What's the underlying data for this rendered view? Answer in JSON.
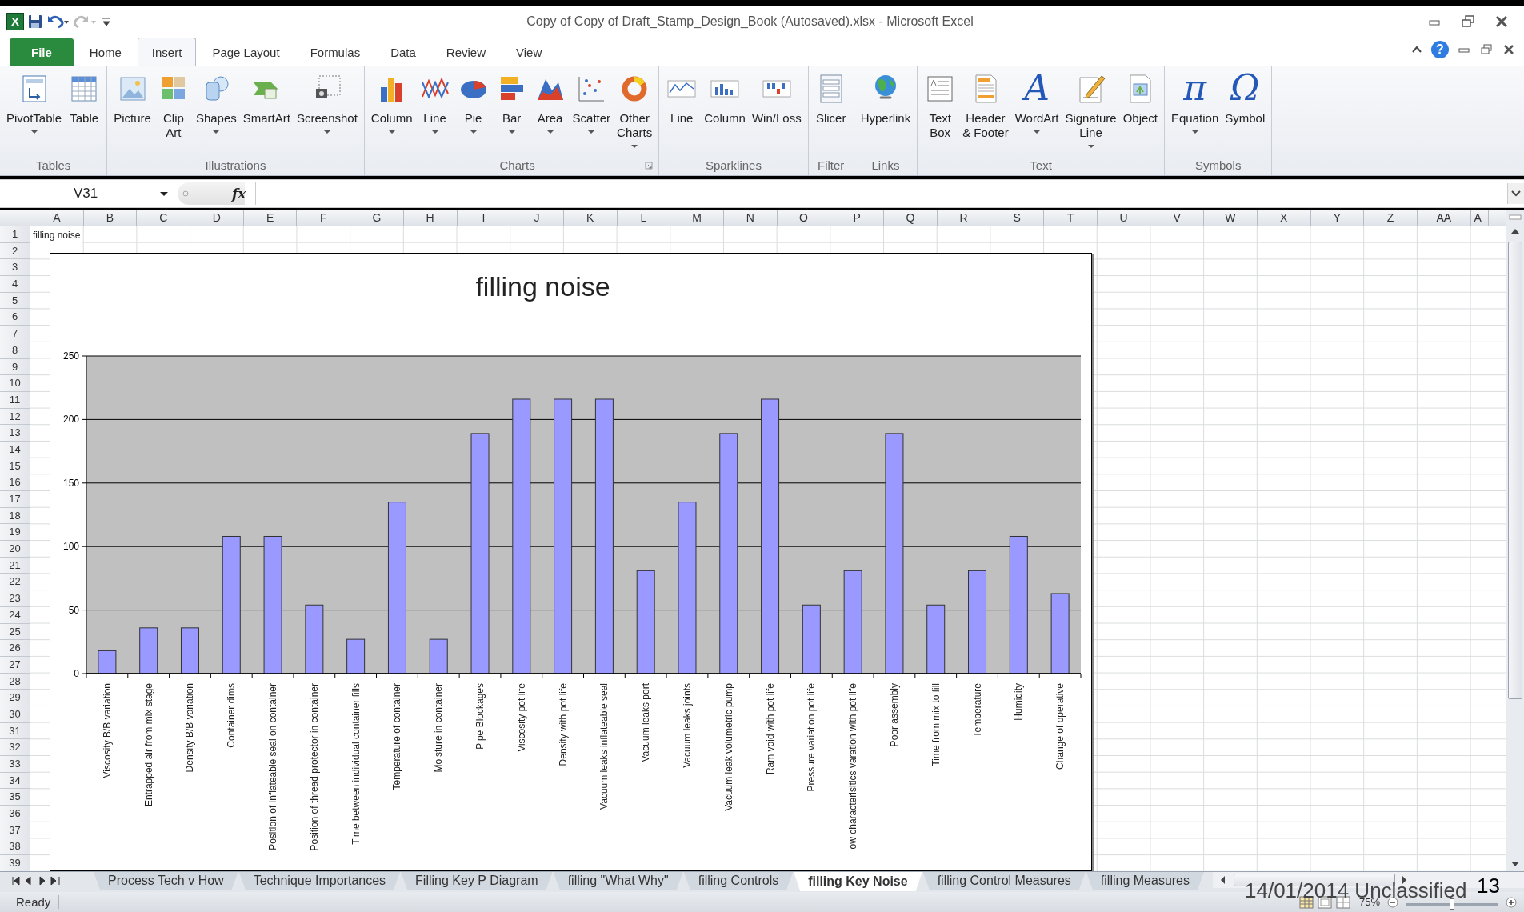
{
  "window": {
    "title": "Copy of Copy of Draft_Stamp_Design_Book (Autosaved).xlsx  -  Microsoft Excel"
  },
  "quick_access": {
    "app_glyph": "X",
    "redo_disabled": true
  },
  "tabs": [
    {
      "label": "File",
      "kind": "file",
      "selected": false
    },
    {
      "label": "Home",
      "kind": "tab",
      "selected": false
    },
    {
      "label": "Insert",
      "kind": "tab",
      "selected": true
    },
    {
      "label": "Page Layout",
      "kind": "tab",
      "selected": false
    },
    {
      "label": "Formulas",
      "kind": "tab",
      "selected": false
    },
    {
      "label": "Data",
      "kind": "tab",
      "selected": false
    },
    {
      "label": "Review",
      "kind": "tab",
      "selected": false
    },
    {
      "label": "View",
      "kind": "tab",
      "selected": false
    }
  ],
  "help_glyph": "?",
  "ribbon": [
    {
      "label": "Tables",
      "launcher": false,
      "buttons": [
        {
          "lines": [
            "PivotTable"
          ],
          "dropdown": true
        },
        {
          "lines": [
            "Table"
          ],
          "dropdown": false
        }
      ]
    },
    {
      "label": "Illustrations",
      "launcher": false,
      "buttons": [
        {
          "lines": [
            "Picture"
          ],
          "dropdown": false
        },
        {
          "lines": [
            "Clip",
            "Art"
          ],
          "dropdown": false
        },
        {
          "lines": [
            "Shapes"
          ],
          "dropdown": true
        },
        {
          "lines": [
            "SmartArt"
          ],
          "dropdown": false
        },
        {
          "lines": [
            "Screenshot"
          ],
          "dropdown": true
        }
      ]
    },
    {
      "label": "Charts",
      "launcher": true,
      "buttons": [
        {
          "lines": [
            "Column"
          ],
          "dropdown": true
        },
        {
          "lines": [
            "Line"
          ],
          "dropdown": true
        },
        {
          "lines": [
            "Pie"
          ],
          "dropdown": true
        },
        {
          "lines": [
            "Bar"
          ],
          "dropdown": true
        },
        {
          "lines": [
            "Area"
          ],
          "dropdown": true
        },
        {
          "lines": [
            "Scatter"
          ],
          "dropdown": true
        },
        {
          "lines": [
            "Other",
            "Charts"
          ],
          "dropdown": true
        }
      ]
    },
    {
      "label": "Sparklines",
      "launcher": false,
      "buttons": [
        {
          "lines": [
            "Line"
          ],
          "dropdown": false
        },
        {
          "lines": [
            "Column"
          ],
          "dropdown": false
        },
        {
          "lines": [
            "Win/Loss"
          ],
          "dropdown": false
        }
      ]
    },
    {
      "label": "Filter",
      "launcher": false,
      "buttons": [
        {
          "lines": [
            "Slicer"
          ],
          "dropdown": false
        }
      ]
    },
    {
      "label": "Links",
      "launcher": false,
      "buttons": [
        {
          "lines": [
            "Hyperlink"
          ],
          "dropdown": false
        }
      ]
    },
    {
      "label": "Text",
      "launcher": false,
      "buttons": [
        {
          "lines": [
            "Text",
            "Box"
          ],
          "dropdown": false
        },
        {
          "lines": [
            "Header",
            "& Footer"
          ],
          "dropdown": false
        },
        {
          "lines": [
            "WordArt"
          ],
          "dropdown": true,
          "glyph": "A"
        },
        {
          "lines": [
            "Signature",
            "Line"
          ],
          "dropdown": true
        },
        {
          "lines": [
            "Object"
          ],
          "dropdown": false
        }
      ]
    },
    {
      "label": "Symbols",
      "launcher": false,
      "buttons": [
        {
          "lines": [
            "Equation"
          ],
          "dropdown": true,
          "glyph": "π"
        },
        {
          "lines": [
            "Symbol"
          ],
          "dropdown": false,
          "glyph": "Ω"
        }
      ]
    }
  ],
  "formula_bar": {
    "name_box": "V31",
    "fx": "fx"
  },
  "columns": [
    "A",
    "B",
    "C",
    "D",
    "E",
    "F",
    "G",
    "H",
    "I",
    "J",
    "K",
    "L",
    "M",
    "N",
    "O",
    "P",
    "Q",
    "R",
    "S",
    "T",
    "U",
    "V",
    "W",
    "X",
    "Y",
    "Z",
    "AA",
    "A"
  ],
  "rows": [
    "1",
    "2",
    "3",
    "4",
    "5",
    "6",
    "7",
    "8",
    "9",
    "10",
    "11",
    "12",
    "13",
    "14",
    "15",
    "16",
    "17",
    "18",
    "19",
    "20",
    "21",
    "22",
    "23",
    "24",
    "25",
    "26",
    "27",
    "28",
    "29",
    "30",
    "31",
    "32",
    "33",
    "34",
    "35",
    "36",
    "37",
    "38",
    "39"
  ],
  "cell_a1": "filling noise",
  "chart": {
    "chart_data": {
      "type": "bar",
      "title": "filling noise",
      "categories": [
        "Viscosity B/B variation",
        "Entrapped air from mix stage",
        "Density B/B variation",
        "Container dims",
        "Position of inflateable seal on container",
        "Position of thread protector in container",
        "Time between  individual container fills",
        "Temperature of container",
        "Moisture in container",
        "Pipe Blockages",
        "Viscosity pot life",
        "Density with pot life",
        "Vacuum leaks inflateable seal",
        "Vacuum leaks port",
        "Vacuum leaks joints",
        "Vacuum leak volumetric pump",
        "Ram void with pot life",
        "Pressure variation pot life",
        "ow characterisitics varation with pot life",
        "Poor assembly",
        "Time from mix to fill",
        "Temperature",
        "Humidity",
        "Change of operative"
      ],
      "series": [
        {
          "color": "#9999ff",
          "values": [
            18,
            36,
            36,
            108,
            108,
            54,
            27,
            135,
            27,
            189,
            216,
            216,
            216,
            81,
            135,
            189,
            216,
            54,
            81,
            189,
            54,
            81,
            108,
            63
          ]
        }
      ],
      "ylim": [
        0,
        250
      ],
      "grid": true,
      "yticks": [
        0,
        50,
        100,
        150,
        200,
        250
      ]
    }
  },
  "sheet_tabs": [
    {
      "label": "Process Tech v How",
      "selected": false
    },
    {
      "label": "Technique Importances",
      "selected": false
    },
    {
      "label": "Filling Key P Diagram",
      "selected": false
    },
    {
      "label": "filling \"What Why\"",
      "selected": false
    },
    {
      "label": "filling Controls",
      "selected": false
    },
    {
      "label": "filling Key Noise",
      "selected": true
    },
    {
      "label": "filling Control Measures",
      "selected": false
    },
    {
      "label": "filling Measures",
      "selected": false
    }
  ],
  "status_bar": {
    "status": "Ready",
    "zoom": "75%",
    "zoom_slider": {
      "level": 0.5
    }
  },
  "slide_footer": {
    "date_classification": "14/01/2014 Unclassified",
    "page_number": "13"
  }
}
